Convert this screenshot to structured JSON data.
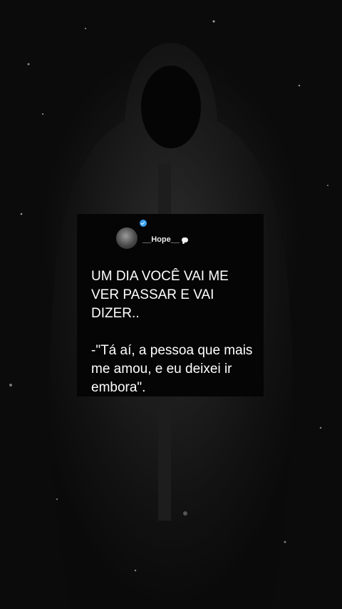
{
  "post": {
    "username": "__Hope__",
    "line1": "UM DIA VOCÊ VAI ME",
    "line2": "VER PASSAR E VAI",
    "line3": "DIZER..",
    "line4": "-\"Tá aí, a pessoa que mais",
    "line5": "me amou, e eu deixei ir",
    "line6": "embora\"."
  },
  "icons": {
    "verified": "verified-badge-icon",
    "bubble": "speech-bubble-icon"
  },
  "colors": {
    "background": "#0b0b0b",
    "card": "#050505",
    "text": "#ffffff",
    "verified": "#3aa1f2"
  }
}
